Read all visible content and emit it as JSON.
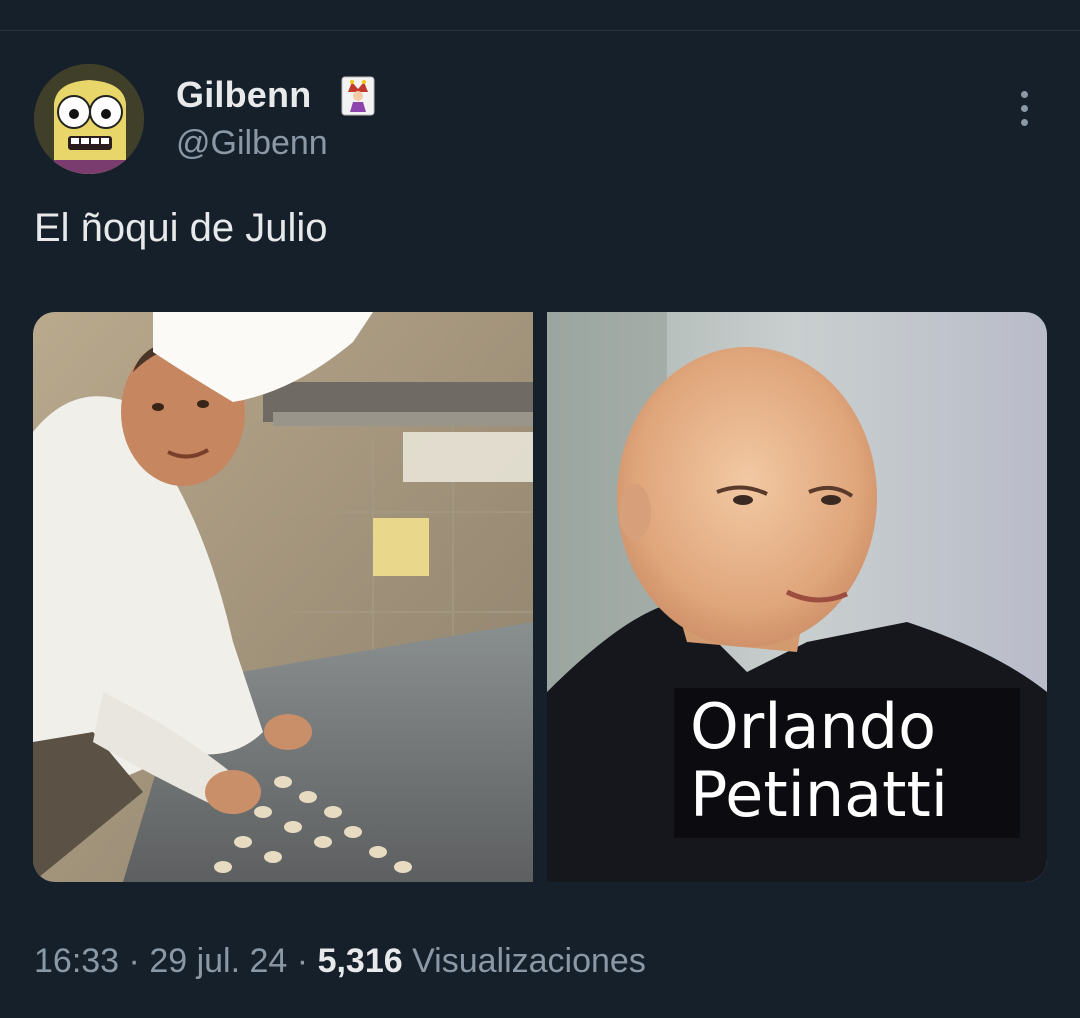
{
  "tweet": {
    "author": {
      "display_name": "Gilbenn",
      "handle": "@Gilbenn",
      "name_emoji": "joker-card-emoji",
      "avatar": "cartoon-character-avatar"
    },
    "text": "El ñoqui de Julio",
    "media": {
      "left_image": "chef-making-gnocchi-photo",
      "right_image": "bald-man-portrait-photo",
      "right_caption_line1": "Orlando",
      "right_caption_line2": "Petinatti"
    },
    "meta": {
      "time": "16:33",
      "separator": "·",
      "date": "29 jul. 24",
      "views_count": "5,316",
      "views_label": "Visualizaciones"
    }
  },
  "icons": {
    "more": "more-options-icon"
  },
  "colors": {
    "background": "#15202b",
    "primary_text": "#e7e9ea",
    "secondary_text": "#8b98a5"
  }
}
